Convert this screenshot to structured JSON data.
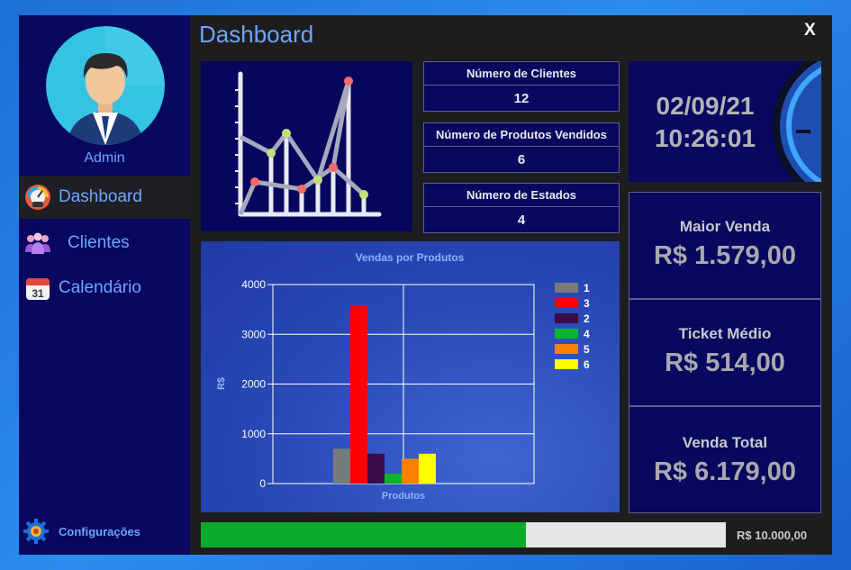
{
  "window": {
    "title": "Dashboard",
    "close_label": "X"
  },
  "sidebar": {
    "user_name": "Admin",
    "items": [
      {
        "label": "Dashboard",
        "icon": "speedometer-icon",
        "active": true
      },
      {
        "label": "Clientes",
        "icon": "users-icon",
        "active": false
      },
      {
        "label": "Calendário",
        "icon": "calendar-icon",
        "active": false
      }
    ],
    "calendar_day": "31",
    "settings_label": "Configurações"
  },
  "stats": [
    {
      "label": "Número de Clientes",
      "value": "12"
    },
    {
      "label": "Número de Produtos Vendidos",
      "value": "6"
    },
    {
      "label": "Número de Estados",
      "value": "4"
    }
  ],
  "clock": {
    "date": "02/09/21",
    "time": "10:26:01"
  },
  "kpis": [
    {
      "label": "Maior Venda",
      "value": "R$ 1.579,00"
    },
    {
      "label": "Ticket Médio",
      "value": "R$ 514,00"
    },
    {
      "label": "Venda Total",
      "value": "R$ 6.179,00"
    }
  ],
  "goal": {
    "progress_fraction": 0.62,
    "label": "R$ 10.000,00"
  },
  "colors": {
    "sidebar_bg": "#07085e",
    "accent_text": "#6fa4ff",
    "progress_fill": "#0cab2b"
  },
  "chart_data": {
    "type": "bar",
    "title": "Vendas por Produtos",
    "xlabel": "Produtos",
    "ylabel": "R$",
    "ylim": [
      0,
      4000
    ],
    "yticks": [
      "0",
      "1000",
      "2000",
      "3000",
      "4000"
    ],
    "grid": true,
    "legend_position": "top-right",
    "series": [
      {
        "name": "1",
        "value": 700,
        "color": "#7a7a7a"
      },
      {
        "name": "3",
        "value": 3580,
        "color": "#ff0000"
      },
      {
        "name": "2",
        "value": 600,
        "color": "#3b0c47"
      },
      {
        "name": "4",
        "value": 200,
        "color": "#0cb52a"
      },
      {
        "name": "5",
        "value": 500,
        "color": "#ff8000"
      },
      {
        "name": "6",
        "value": 600,
        "color": "#ffff00"
      }
    ]
  }
}
